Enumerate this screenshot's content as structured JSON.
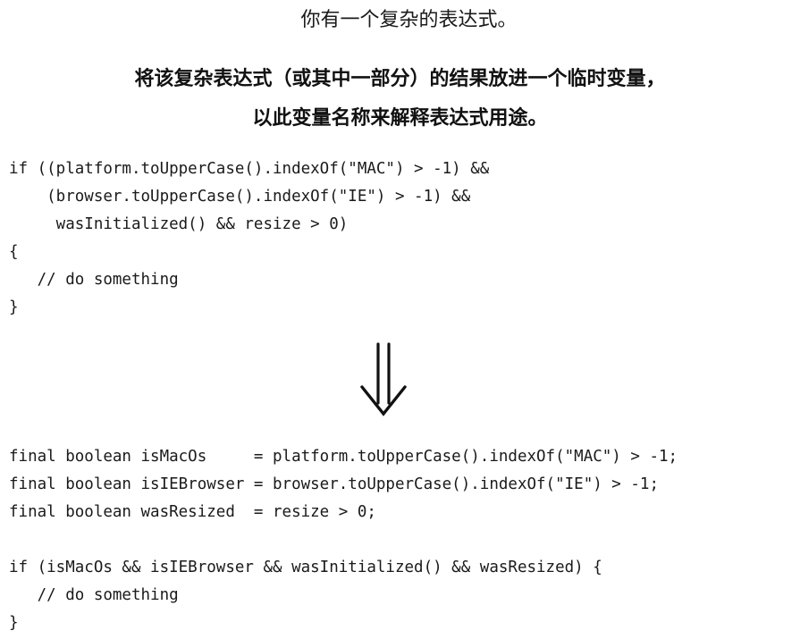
{
  "problem_text": "你有一个复杂的表达式。",
  "solution": {
    "line1": "将该复杂表达式（或其中一部分）的结果放进一个临时变量，",
    "line2": "以此变量名称来解释表达式用途。"
  },
  "before_code": [
    "if ((platform.toUpperCase().indexOf(\"MAC\") > -1) &&",
    "    (browser.toUpperCase().indexOf(\"IE\") > -1) &&",
    "     wasInitialized() && resize > 0)",
    "{",
    "   // do something",
    "}"
  ],
  "after_code": [
    "final boolean isMacOs     = platform.toUpperCase().indexOf(\"MAC\") > -1;",
    "final boolean isIEBrowser = browser.toUpperCase().indexOf(\"IE\") > -1;",
    "final boolean wasResized  = resize > 0;",
    "",
    "if (isMacOs && isIEBrowser && wasInitialized() && wasResized) {",
    "   // do something",
    "}"
  ],
  "arrow_icon": "double-down-arrow-icon"
}
